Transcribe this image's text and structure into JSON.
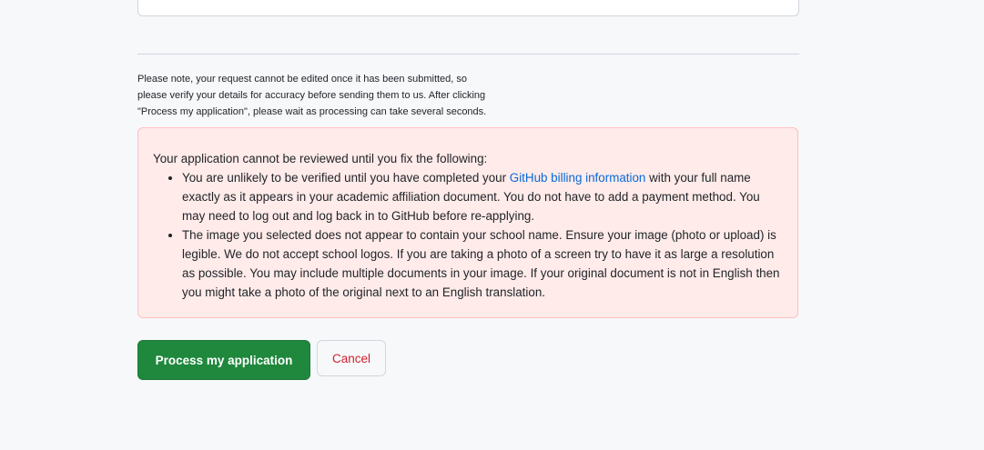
{
  "note": {
    "lines": [
      "Please note, your request cannot be edited once it has been submitted, so",
      "please verify your details for accuracy before sending them to us. After clicking",
      "\"Process my application\", please wait as processing can take several seconds."
    ]
  },
  "error": {
    "title": "Your application cannot be reviewed until you fix the following:",
    "item1_before": "You are unlikely to be verified until you have completed your ",
    "item1_link": "GitHub billing information",
    "item1_after": " with your full name exactly as it appears in your academic affiliation document. You do not have to add a payment method. You may need to log out and log back in to GitHub before re-applying.",
    "item2": "The image you selected does not appear to contain your school name. Ensure your image (photo or upload) is legible. We do not accept school logos. If you are taking a photo of a screen try to have it as large a resolution as possible. You may include multiple documents in your image. If your original document is not in English then you might take a photo of the original next to an English translation."
  },
  "buttons": {
    "process_label": "Process my application",
    "cancel_label": "Cancel"
  },
  "colors": {
    "primary_button": "#1f883d",
    "cancel_text": "#cf222e",
    "link": "#0969da",
    "error_bg": "#ffebe9",
    "error_border": "#ffc1c0"
  }
}
